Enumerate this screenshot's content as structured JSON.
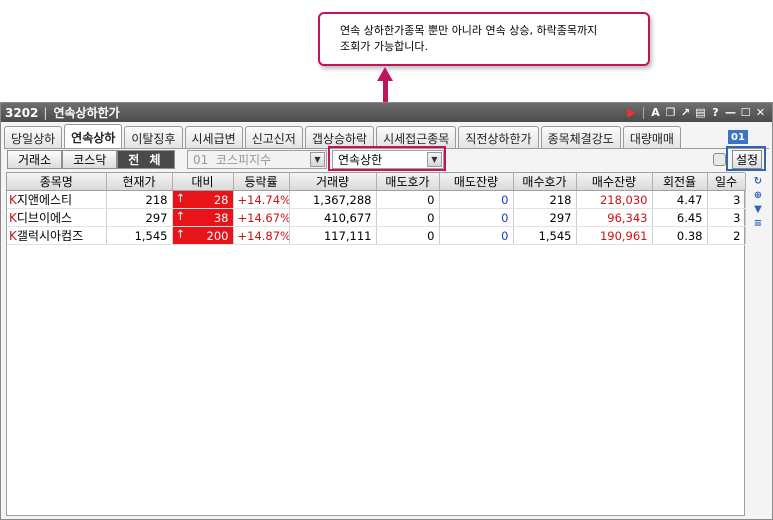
{
  "callout": {
    "line1": "연속 상하한가종목 뿐만 아니라 연속 상승, 하락종목까지",
    "line2": "조회가 가능합니다."
  },
  "window": {
    "code": "3202",
    "title": "연속상하한가",
    "icons": [
      "play-icon",
      "font-icon",
      "copy-icon",
      "link-icon",
      "print-icon",
      "help-icon",
      "minimize-icon",
      "maximize-icon",
      "close-icon"
    ]
  },
  "tabs": [
    "당일상하",
    "연속상하",
    "이탈징후",
    "시세급변",
    "신고신저",
    "갭상승하락",
    "시세접근종목",
    "직전상하한가",
    "종목체결강도",
    "대량매매"
  ],
  "active_tab": "연속상하",
  "tab_badge": "01",
  "market_buttons": [
    "거래소",
    "코스닥",
    "전 체"
  ],
  "index_combo": "01  코스피지수",
  "type_combo": "연속상한",
  "settings_button": "설정",
  "table": {
    "headers": [
      "종목명",
      "현재가",
      "대비",
      "등락률",
      "거래량",
      "매도호가",
      "매도잔량",
      "매수호가",
      "매수잔량",
      "회전율",
      "일수"
    ],
    "rows": [
      {
        "marker": "K",
        "name": "지앤에스티",
        "price": "218",
        "change": "28",
        "rate": "+14.74%",
        "volume": "1,367,288",
        "ask": "0",
        "ask_qty": "0",
        "bid": "218",
        "bid_qty": "218,030",
        "turnover": "4.47",
        "days": "3"
      },
      {
        "marker": "K",
        "name": "디브이에스",
        "price": "297",
        "change": "38",
        "rate": "+14.67%",
        "volume": "410,677",
        "ask": "0",
        "ask_qty": "0",
        "bid": "297",
        "bid_qty": "96,343",
        "turnover": "6.45",
        "days": "3"
      },
      {
        "marker": "K",
        "name": "갤럭시아컴즈",
        "price": "1,545",
        "change": "200",
        "rate": "+14.87%",
        "volume": "117,111",
        "ask": "0",
        "ask_qty": "0",
        "bid": "1,545",
        "bid_qty": "190,961",
        "turnover": "0.38",
        "days": "2"
      }
    ],
    "up_arrow": "↑"
  },
  "colors": {
    "accent": "#c0145c",
    "up": "#e8141a",
    "blue": "#1a3fb0",
    "badge": "#3a74c2"
  }
}
